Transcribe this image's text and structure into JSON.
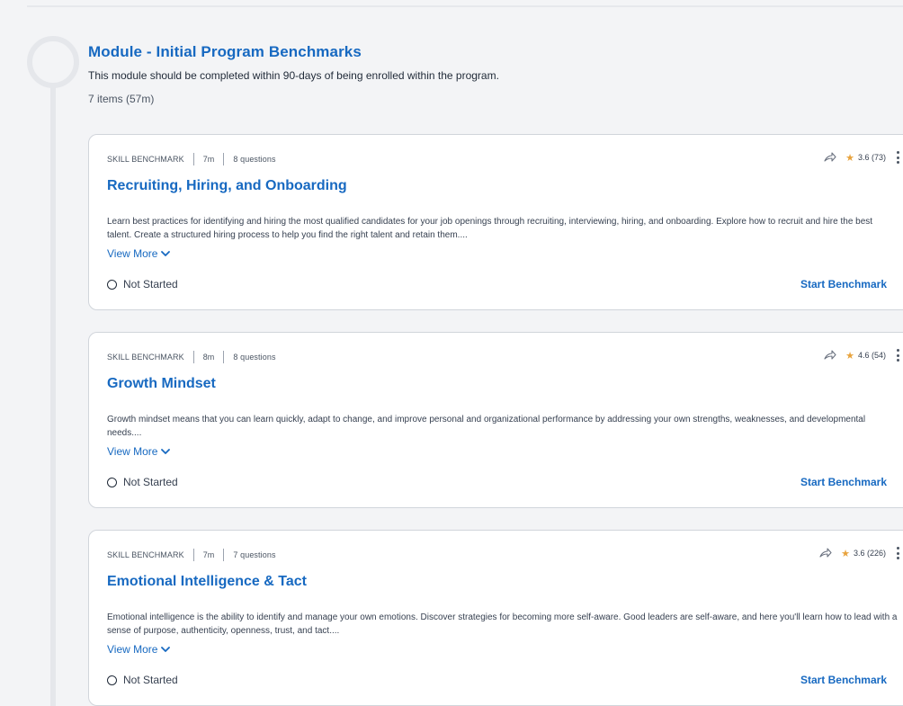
{
  "module": {
    "title": "Module - Initial Program Benchmarks",
    "description": "This module should be completed within 90-days of being enrolled within the program.",
    "meta": "7 items  (57m)"
  },
  "icons": {
    "share": "share-icon",
    "star": "star-icon",
    "more": "kebab-icon",
    "view_more": "chevron-down-icon",
    "status": "circle-outline-icon"
  },
  "colors": {
    "link_blue": "#1769c1",
    "star_orange": "#e8a33d"
  },
  "cards": [
    {
      "type": "SKILL BENCHMARK",
      "duration": "7m",
      "questions": "8 questions",
      "rating": "3.6 (73)",
      "title": "Recruiting, Hiring, and Onboarding",
      "description": "Learn best practices for identifying and hiring the most qualified candidates for your job openings through recruiting, interviewing, hiring, and onboarding. Explore how to recruit and hire the best talent. Create a structured hiring process to help you find the right talent and retain them....",
      "view_more": "View More",
      "status": "Not Started",
      "action": "Start Benchmark"
    },
    {
      "type": "SKILL BENCHMARK",
      "duration": "8m",
      "questions": "8 questions",
      "rating": "4.6 (54)",
      "title": "Growth Mindset",
      "description": "Growth mindset means that you can learn quickly, adapt to change, and improve personal and organizational performance by addressing your own strengths, weaknesses, and developmental needs....",
      "view_more": "View More",
      "status": "Not Started",
      "action": "Start Benchmark"
    },
    {
      "type": "SKILL BENCHMARK",
      "duration": "7m",
      "questions": "7 questions",
      "rating": "3.6 (226)",
      "title": "Emotional Intelligence & Tact",
      "description": "Emotional intelligence is the ability to identify and manage your own emotions. Discover strategies for becoming more self-aware. Good leaders are self-aware, and here you'll learn how to lead with a sense of purpose, authenticity, openness, trust, and tact....",
      "view_more": "View More",
      "status": "Not Started",
      "action": "Start Benchmark"
    }
  ]
}
